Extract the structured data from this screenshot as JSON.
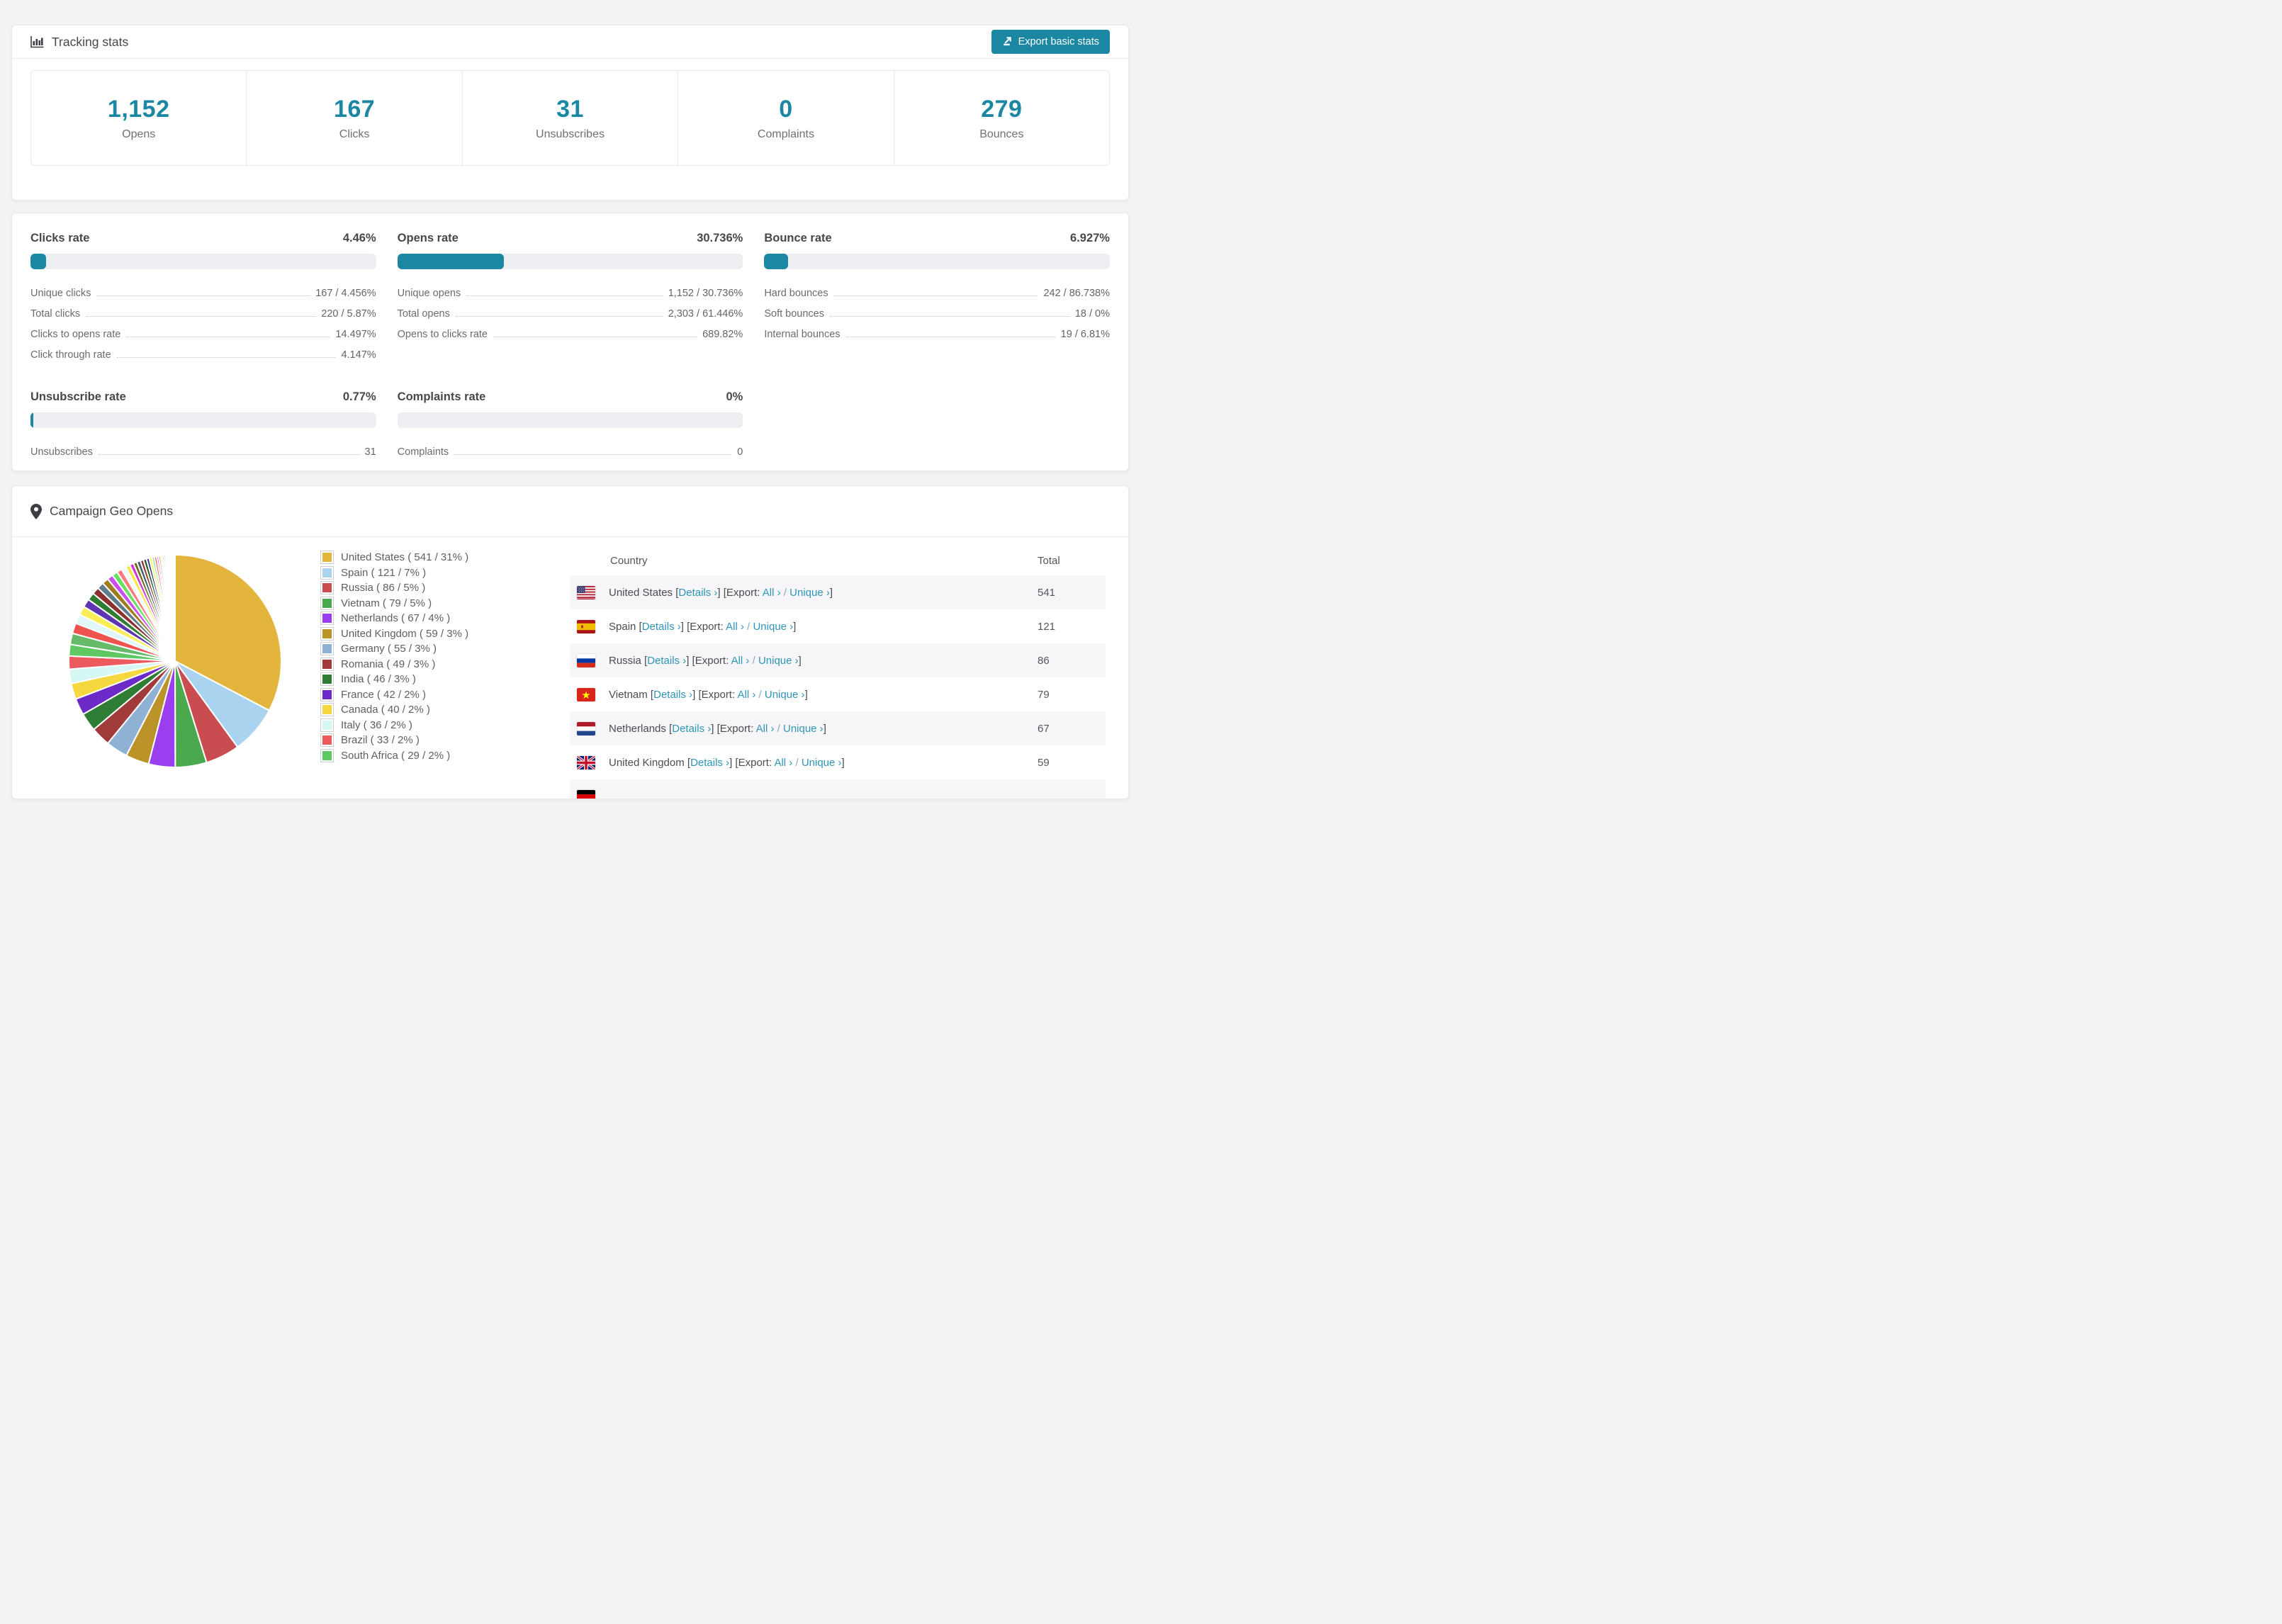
{
  "accent_color": "#1b87a2",
  "link_color": "#2f95b8",
  "header": {
    "title": "Tracking stats",
    "export_button": "Export basic stats"
  },
  "summary_stats": [
    {
      "value": "1,152",
      "label": "Opens"
    },
    {
      "value": "167",
      "label": "Clicks"
    },
    {
      "value": "31",
      "label": "Unsubscribes"
    },
    {
      "value": "0",
      "label": "Complaints"
    },
    {
      "value": "279",
      "label": "Bounces"
    }
  ],
  "rate_panels": [
    {
      "title": "Clicks rate",
      "value": "4.46%",
      "percent": 4.46,
      "rows": [
        {
          "label": "Unique clicks",
          "value": "167 / 4.456%"
        },
        {
          "label": "Total clicks",
          "value": "220 / 5.87%"
        },
        {
          "label": "Clicks to opens rate",
          "value": "14.497%"
        },
        {
          "label": "Click through rate",
          "value": "4.147%"
        }
      ]
    },
    {
      "title": "Opens rate",
      "value": "30.736%",
      "percent": 30.736,
      "rows": [
        {
          "label": "Unique opens",
          "value": "1,152 / 30.736%"
        },
        {
          "label": "Total opens",
          "value": "2,303 / 61.446%"
        },
        {
          "label": "Opens to clicks rate",
          "value": "689.82%"
        }
      ]
    },
    {
      "title": "Bounce rate",
      "value": "6.927%",
      "percent": 6.927,
      "rows": [
        {
          "label": "Hard bounces",
          "value": "242 / 86.738%"
        },
        {
          "label": "Soft bounces",
          "value": "18 / 0%"
        },
        {
          "label": "Internal bounces",
          "value": "19 / 6.81%"
        }
      ]
    },
    {
      "title": "Unsubscribe rate",
      "value": "0.77%",
      "percent": 0.77,
      "rows": [
        {
          "label": "Unsubscribes",
          "value": "31"
        }
      ]
    },
    {
      "title": "Complaints rate",
      "value": "0%",
      "percent": 0,
      "rows": [
        {
          "label": "Complaints",
          "value": "0"
        }
      ]
    }
  ],
  "geo": {
    "title": "Campaign Geo Opens",
    "chart_data": {
      "type": "pie",
      "title": "Campaign Geo Opens",
      "start_angle_deg": -90,
      "direction": "clockwise",
      "slices": [
        {
          "label": "United States",
          "value": 541,
          "percent_label": "31%",
          "color": "#e3b53d"
        },
        {
          "label": "Spain",
          "value": 121,
          "percent_label": "7%",
          "color": "#a9d3ee"
        },
        {
          "label": "Russia",
          "value": 86,
          "percent_label": "5%",
          "color": "#c94c50"
        },
        {
          "label": "Vietnam",
          "value": 79,
          "percent_label": "5%",
          "color": "#4aa84e"
        },
        {
          "label": "Netherlands",
          "value": 67,
          "percent_label": "4%",
          "color": "#9b3ef0"
        },
        {
          "label": "United Kingdom",
          "value": 59,
          "percent_label": "3%",
          "color": "#bb9329"
        },
        {
          "label": "Germany",
          "value": 55,
          "percent_label": "3%",
          "color": "#8fb2d4"
        },
        {
          "label": "Romania",
          "value": 49,
          "percent_label": "3%",
          "color": "#a13b3b"
        },
        {
          "label": "India",
          "value": 46,
          "percent_label": "3%",
          "color": "#2f7d35"
        },
        {
          "label": "France",
          "value": 42,
          "percent_label": "2%",
          "color": "#6c2bc8"
        },
        {
          "label": "Canada",
          "value": 40,
          "percent_label": "2%",
          "color": "#f5d83f"
        },
        {
          "label": "Italy",
          "value": 36,
          "percent_label": "2%",
          "color": "#d6f8f4"
        },
        {
          "label": "Brazil",
          "value": 33,
          "percent_label": "2%",
          "color": "#ec5a5e"
        },
        {
          "label": "South Africa",
          "value": 29,
          "percent_label": "2%",
          "color": "#5ec962"
        }
      ],
      "tail_slices_estimated": [
        28,
        26,
        24,
        22,
        21,
        19,
        18,
        17,
        16,
        15,
        14,
        13,
        12,
        11,
        10,
        9,
        9,
        8,
        8,
        7,
        7,
        6,
        6,
        5,
        5,
        4,
        4,
        4,
        3,
        3,
        3,
        2,
        2,
        2,
        2,
        1,
        1,
        1,
        1,
        1,
        1,
        1
      ],
      "tail_palette": [
        "#66bb6a",
        "#ef5350",
        "#e0f7fa",
        "#f9ee58",
        "#5e35b1",
        "#2e7d32",
        "#8d3030",
        "#607d8b",
        "#9e7c20",
        "#c94ef0",
        "#69e062",
        "#ff7a7a",
        "#f2fcfb",
        "#f6e943",
        "#d036d0",
        "#6b6b1a",
        "#44606e",
        "#93312f",
        "#235e28",
        "#2a2a80",
        "#f7f74f",
        "#7ef07e",
        "#ff5c5c",
        "#e056fd",
        "#d4a017",
        "#9fd4f5",
        "#e05252",
        "#3fa044",
        "#8e44ad",
        "#c8c8ee"
      ]
    },
    "legend_format": {
      "open": "(",
      "separator": "/",
      "close": ")"
    },
    "table": {
      "columns": [
        "Country",
        "Total"
      ],
      "links": {
        "details": "Details",
        "export_prefix": "Export:",
        "all": "All",
        "unique": "Unique",
        "chevron": "›"
      },
      "rows": [
        {
          "flag": "us",
          "country": "United States",
          "total": "541"
        },
        {
          "flag": "es",
          "country": "Spain",
          "total": "121"
        },
        {
          "flag": "ru",
          "country": "Russia",
          "total": "86"
        },
        {
          "flag": "vn",
          "country": "Vietnam",
          "total": "79"
        },
        {
          "flag": "nl",
          "country": "Netherlands",
          "total": "67"
        },
        {
          "flag": "gb",
          "country": "United Kingdom",
          "total": "59"
        },
        {
          "flag": "de",
          "country": "",
          "total": "",
          "partial": true
        }
      ]
    }
  }
}
